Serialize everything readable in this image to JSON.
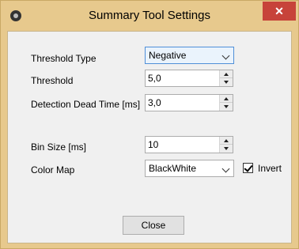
{
  "window": {
    "title": "Summary Tool Settings",
    "close_label": "✕"
  },
  "form": {
    "threshold_type": {
      "label": "Threshold Type",
      "value": "Negative"
    },
    "threshold": {
      "label": "Threshold",
      "value": "5,0"
    },
    "dead_time": {
      "label": "Detection Dead Time [ms]",
      "value": "3,0"
    },
    "bin_size": {
      "label": "Bin Size [ms]",
      "value": "10"
    },
    "color_map": {
      "label": "Color Map",
      "value": "BlackWhite"
    },
    "invert": {
      "label": "Invert",
      "checked": true
    }
  },
  "buttons": {
    "close": "Close"
  },
  "colors": {
    "frame": "#e7c98d",
    "client": "#f0f0f0",
    "close_button": "#c7433a",
    "focus_border": "#4f8fd8"
  },
  "icons": [
    "app-icon",
    "close-icon",
    "chevron-down-icon",
    "spin-up-icon",
    "spin-down-icon",
    "checkmark-icon"
  ]
}
